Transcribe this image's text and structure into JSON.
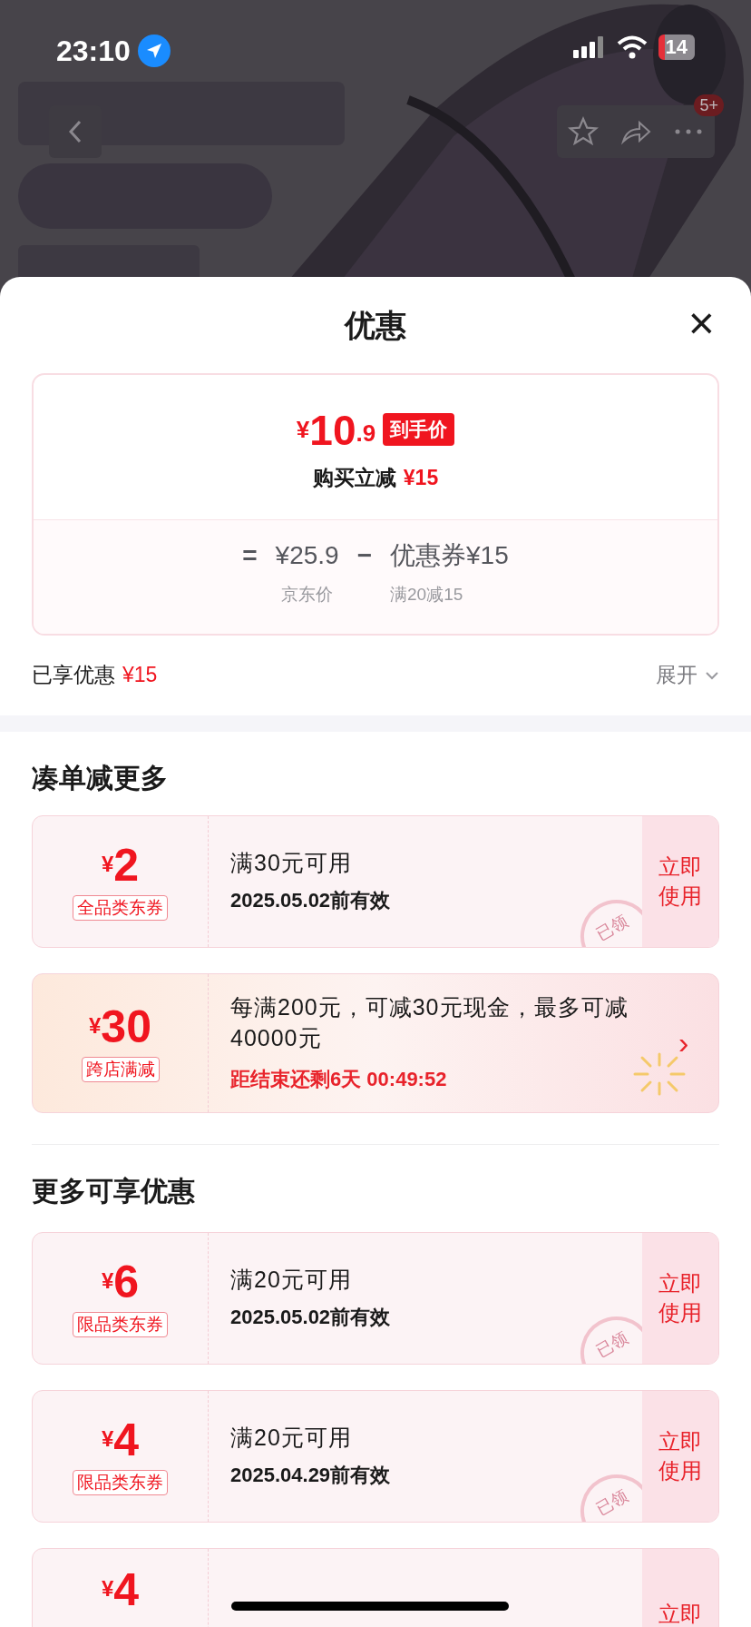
{
  "status_bar": {
    "time": "23:10",
    "battery": "14"
  },
  "nav": {
    "badge": "5+"
  },
  "sheet": {
    "title": "优惠",
    "close": "×"
  },
  "price_card": {
    "currency": "¥",
    "price_int": "10",
    "price_dec": ".9",
    "price_tag": "到手价",
    "summary": "购买立减",
    "summary_amount": "¥15",
    "equals": "=",
    "base_price": "¥25.9",
    "base_label": "京东价",
    "minus": "−",
    "coupon_label": "优惠券",
    "coupon_amount": "¥15",
    "coupon_rule": "满20减15"
  },
  "enjoyed": {
    "label": "已享优惠",
    "amount": "¥15",
    "expand": "展开"
  },
  "sections": [
    {
      "title": "凑单减更多",
      "coupons": [
        {
          "kind": "coupon",
          "currency": "¥",
          "amount": "2",
          "tag": "全品类东券",
          "condition": "满30元可用",
          "validity": "2025.05.02前有效",
          "action": "立即使用",
          "stamp": "已领"
        },
        {
          "kind": "promo",
          "currency": "¥",
          "amount": "30",
          "tag": "跨店满减",
          "condition": "每满200元，可减30元现金，最多可减40000元",
          "countdown": "距结束还剩6天 00:49:52",
          "arrow": "›"
        }
      ]
    },
    {
      "title": "更多可享优惠",
      "coupons": [
        {
          "kind": "coupon",
          "currency": "¥",
          "amount": "6",
          "tag": "限品类东券",
          "condition": "满20元可用",
          "validity": "2025.05.02前有效",
          "action": "立即使用",
          "stamp": "已领"
        },
        {
          "kind": "coupon",
          "currency": "¥",
          "amount": "4",
          "tag": "限品类东券",
          "condition": "满20元可用",
          "validity": "2025.04.29前有效",
          "action": "立即使用",
          "stamp": "已领"
        },
        {
          "kind": "coupon",
          "currency": "¥",
          "amount": "4",
          "action": "立即"
        }
      ]
    }
  ]
}
